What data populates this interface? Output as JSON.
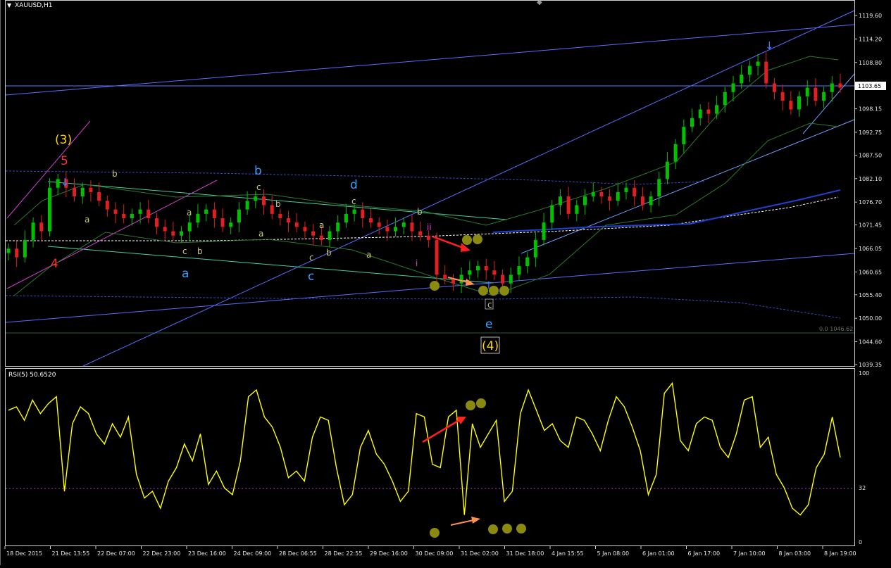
{
  "main_title": "XAUUSD,H1",
  "rsi_title": "RSI(5) 50.6520",
  "price_scale": [
    "1119.60",
    "1114.20",
    "1108.80",
    "1103.65",
    "1098.15",
    "1092.75",
    "1087.50",
    "1082.10",
    "1076.70",
    "1071.45",
    "1066.05",
    "1060.65",
    "1055.40",
    "1050.00",
    "1044.60",
    "1039.35"
  ],
  "current_price": "1103.65",
  "fib_label": "0.0 1046.62",
  "rsi_scale": [
    "100",
    "32",
    "0"
  ],
  "time_axis": [
    "18 Dec 2015",
    "21 Dec 13:55",
    "22 Dec 07:00",
    "22 Dec 23:00",
    "23 Dec 16:00",
    "24 Dec 09:00",
    "28 Dec 06:55",
    "28 Dec 22:55",
    "29 Dec 16:00",
    "30 Dec 09:00",
    "31 Dec 02:00",
    "31 Dec 18:00",
    "4 Jan 15:55",
    "5 Jan 08:00",
    "6 Jan 01:00",
    "6 Jan 17:00",
    "7 Jan 10:00",
    "8 Jan 03:00",
    "8 Jan 19:00"
  ],
  "wave_labels": {
    "w3": "(3)",
    "w5": "5",
    "w4_red": "4",
    "a_big": "a",
    "b_big": "b",
    "c_big": "c",
    "d_big": "d",
    "e_big": "e",
    "w4_box": "(4)",
    "i": "i",
    "ii": "ii",
    "sm_b1": "b",
    "sm_a1": "a",
    "sm_a2": "a",
    "sm_c1": "c",
    "sm_b2": "b",
    "sm_c2": "c",
    "sm_b3": "b",
    "sm_a3": "a",
    "sm_a4": "a",
    "sm_c3": "c",
    "sm_b4": "b",
    "sm_c4": "c",
    "sm_a5": "a",
    "sm_b5": "b",
    "sm_c5": "c"
  },
  "colors": {
    "bull": "#00c000",
    "bear": "#e02020",
    "wave_blue": "#3aa0ff",
    "gold": "#ffd400",
    "magenta": "#d040d0",
    "rsi": "#ffff00",
    "channel": "#7070ff",
    "cyan_line": "#40e0a0"
  },
  "chart_data": {
    "type": "candlestick_with_rsi",
    "symbol": "XAUUSD",
    "timeframe": "H1",
    "ylim": [
      1039.35,
      1122.0
    ],
    "x_categories": [
      "18 Dec 2015",
      "21 Dec 13:55",
      "22 Dec 07:00",
      "22 Dec 23:00",
      "23 Dec 16:00",
      "24 Dec 09:00",
      "28 Dec 06:55",
      "28 Dec 22:55",
      "29 Dec 16:00",
      "30 Dec 09:00",
      "31 Dec 02:00",
      "31 Dec 18:00",
      "4 Jan 15:55",
      "5 Jan 08:00",
      "6 Jan 01:00",
      "6 Jan 17:00",
      "7 Jan 10:00",
      "8 Jan 03:00",
      "8 Jan 19:00"
    ],
    "close_path": [
      1066,
      1064,
      1068,
      1072,
      1070,
      1080,
      1082,
      1080,
      1078,
      1080,
      1079,
      1077,
      1075,
      1074,
      1073,
      1074,
      1075,
      1073,
      1071,
      1070,
      1069,
      1070,
      1072,
      1074,
      1075,
      1073,
      1071,
      1072,
      1075,
      1077,
      1078,
      1076,
      1074,
      1073,
      1072,
      1071,
      1070,
      1069,
      1068,
      1070,
      1072,
      1074,
      1075,
      1073,
      1072,
      1071,
      1070,
      1071,
      1072,
      1070,
      1069,
      1068,
      1060,
      1059,
      1058,
      1060,
      1061,
      1062,
      1061,
      1060,
      1058,
      1060,
      1062,
      1064,
      1068,
      1072,
      1076,
      1078,
      1074,
      1076,
      1078,
      1079,
      1078,
      1077,
      1079,
      1080,
      1078,
      1076,
      1078,
      1082,
      1086,
      1090,
      1094,
      1096,
      1098,
      1097,
      1099,
      1102,
      1104,
      1106,
      1108,
      1109,
      1104,
      1102,
      1100,
      1098,
      1101,
      1103,
      1100,
      1102,
      1104,
      1103
    ],
    "rsi": {
      "name": "RSI(5)",
      "last": 50.652,
      "ylim": [
        0,
        100
      ],
      "level": 32,
      "values": [
        78,
        80,
        72,
        84,
        76,
        82,
        86,
        30,
        70,
        80,
        76,
        64,
        58,
        70,
        62,
        74,
        40,
        26,
        30,
        20,
        36,
        44,
        58,
        48,
        64,
        34,
        42,
        32,
        28,
        48,
        86,
        90,
        74,
        68,
        56,
        38,
        42,
        36,
        62,
        74,
        72,
        44,
        22,
        28,
        56,
        66,
        52,
        46,
        36,
        24,
        30,
        76,
        74,
        46,
        44,
        74,
        78,
        16,
        70,
        56,
        64,
        72,
        24,
        30,
        76,
        90,
        78,
        66,
        70,
        60,
        56,
        74,
        72,
        64,
        54,
        72,
        86,
        80,
        68,
        54,
        28,
        40,
        88,
        94,
        60,
        54,
        70,
        74,
        72,
        56,
        50,
        64,
        84,
        86,
        56,
        62,
        40,
        32,
        20,
        16,
        22,
        44,
        52,
        74,
        50
      ]
    }
  }
}
